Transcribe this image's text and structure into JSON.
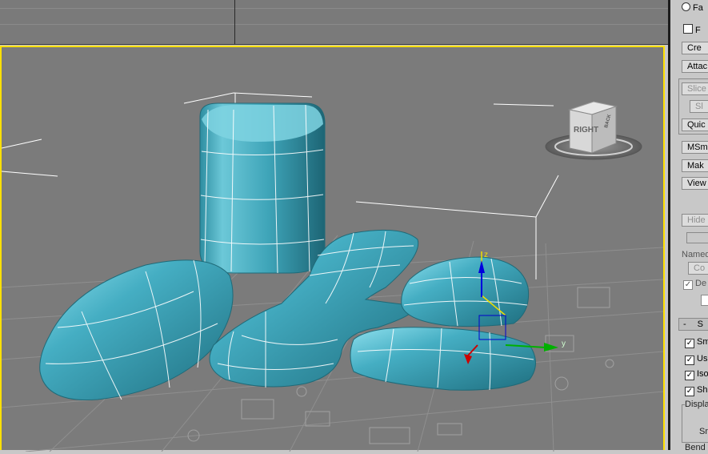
{
  "viewcube": {
    "face_label": "RIGHT",
    "side_label": "BACK"
  },
  "panel": {
    "radio_fa": "Fa",
    "check_f": "F",
    "create_button": "Cre",
    "attach_button": "Attac",
    "slice_button": "Slice",
    "sl_button": "Sl",
    "quick_button": "Quic",
    "msmooth_button": "MSmo",
    "make_button": "Mak",
    "view_button": "View",
    "hide_button": "Hide S",
    "named_label": "Named",
    "co_button": "Co",
    "de_check": "De",
    "rollout_minus": "-",
    "rollout_title": "S",
    "sm_check": "Sm",
    "us_check": "Us",
    "iso_check": "Iso",
    "sh_check": "Sh",
    "display_label": "Displa",
    "sm_label": "Sm",
    "bend_label": "Bend"
  },
  "colors": {
    "viewport_border": "#ffe000",
    "mesh": "#3fa6bb",
    "axis_x": "#cc0000",
    "axis_y": "#00b000",
    "axis_z": "#0000dd"
  },
  "axis_labels": {
    "y": "y",
    "z": "z"
  }
}
